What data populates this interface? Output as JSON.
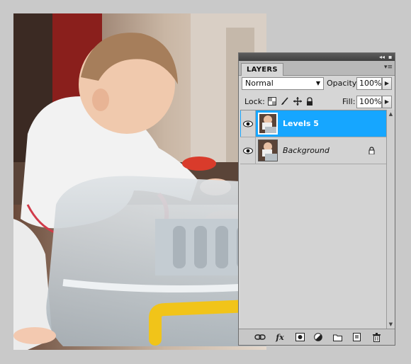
{
  "panel": {
    "tab_label": "LAYERS",
    "collapse_glyph": "◂◂",
    "close_glyph": "▪",
    "menu_glyph": "▾≡",
    "blend_mode": "Normal",
    "opacity_label": "Opacity:",
    "opacity_value": "100%",
    "lock_label": "Lock:",
    "fill_label": "Fill:",
    "fill_value": "100%",
    "layers": [
      {
        "name": "Levels 5",
        "selected": true,
        "visible": true
      },
      {
        "name": "Background",
        "selected": false,
        "visible": true,
        "locked": true
      }
    ],
    "footer_icons": [
      "link-layers-icon",
      "fx-icon",
      "layer-mask-icon",
      "adjustment-layer-icon",
      "new-group-icon",
      "new-layer-icon",
      "trash-icon"
    ],
    "fx_glyph": "fx"
  },
  "colors": {
    "selection": "#16a6ff",
    "panel_bg": "#d6d6d6",
    "page_bg": "#c9c9c9"
  }
}
